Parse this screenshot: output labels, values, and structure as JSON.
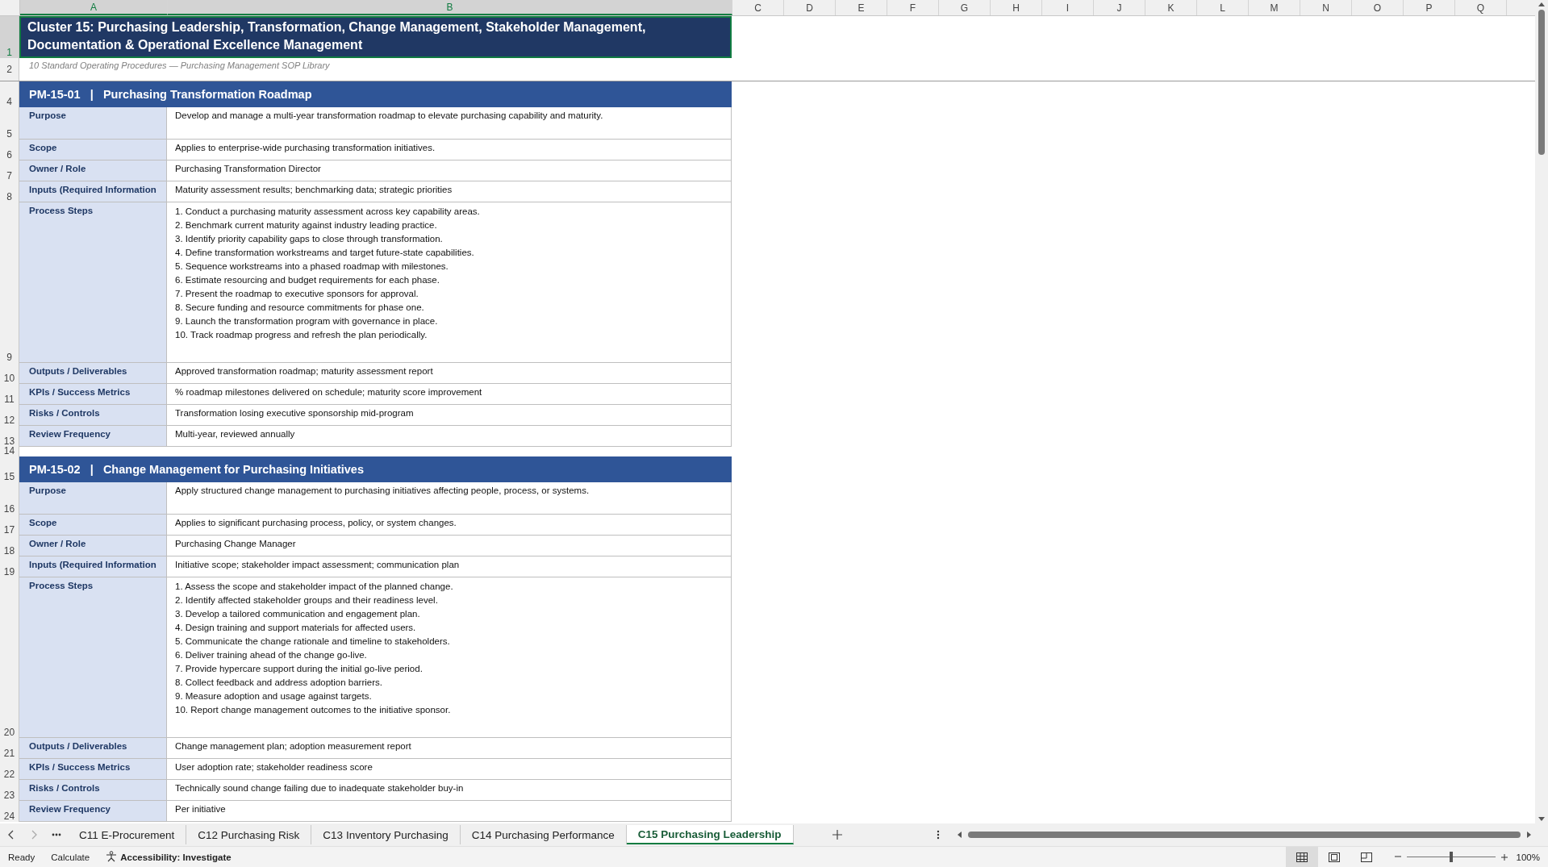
{
  "columns": [
    {
      "label": "A",
      "selected": true
    },
    {
      "label": "B",
      "selected": true
    },
    {
      "label": "C",
      "selected": false
    },
    {
      "label": "D",
      "selected": false
    },
    {
      "label": "E",
      "selected": false
    },
    {
      "label": "F",
      "selected": false
    },
    {
      "label": "G",
      "selected": false
    },
    {
      "label": "H",
      "selected": false
    },
    {
      "label": "I",
      "selected": false
    },
    {
      "label": "J",
      "selected": false
    },
    {
      "label": "K",
      "selected": false
    },
    {
      "label": "L",
      "selected": false
    },
    {
      "label": "M",
      "selected": false
    },
    {
      "label": "N",
      "selected": false
    },
    {
      "label": "O",
      "selected": false
    },
    {
      "label": "P",
      "selected": false
    },
    {
      "label": "Q",
      "selected": false
    }
  ],
  "rows": [
    {
      "kind": "title",
      "number": "1",
      "selected": true,
      "text": "Cluster 15: Purchasing Leadership, Transformation, Change Management, Stakeholder Management, Documentation & Operational Excellence Management"
    },
    {
      "kind": "subtitle",
      "number": "2",
      "selected": false,
      "text": "10 Standard Operating Procedures — Purchasing Management SOP Library"
    },
    {
      "kind": "spacer",
      "selected": false
    },
    {
      "kind": "section",
      "number": "4",
      "selected": false,
      "text": "PM-15-01   |   Purchasing Transformation Roadmap"
    },
    {
      "kind": "field_tall",
      "number": "5",
      "selected": false,
      "label": "Purpose",
      "value": "Develop and manage a multi-year transformation roadmap to elevate purchasing capability and maturity."
    },
    {
      "kind": "field",
      "number": "6",
      "selected": false,
      "label": "Scope",
      "value": "Applies to enterprise-wide purchasing transformation initiatives."
    },
    {
      "kind": "field",
      "number": "7",
      "selected": false,
      "label": "Owner / Role",
      "value": "Purchasing Transformation Director"
    },
    {
      "kind": "field",
      "number": "8",
      "selected": false,
      "label": "Inputs (Required Information",
      "value": "Maturity assessment results; benchmarking data; strategic priorities"
    },
    {
      "kind": "steps",
      "number": "9",
      "selected": false,
      "label": "Process Steps",
      "steps": [
        "1. Conduct a purchasing maturity assessment across key capability areas.",
        "2. Benchmark current maturity against industry leading practice.",
        "3. Identify priority capability gaps to close through transformation.",
        "4. Define transformation workstreams and target future-state capabilities.",
        "5. Sequence workstreams into a phased roadmap with milestones.",
        "6. Estimate resourcing and budget requirements for each phase.",
        "7. Present the roadmap to executive sponsors for approval.",
        "8. Secure funding and resource commitments for phase one.",
        "9. Launch the transformation program with governance in place.",
        "10. Track roadmap progress and refresh the plan periodically."
      ]
    },
    {
      "kind": "field",
      "number": "10",
      "selected": false,
      "label": "Outputs / Deliverables",
      "value": "Approved transformation roadmap; maturity assessment report"
    },
    {
      "kind": "field",
      "number": "11",
      "selected": false,
      "label": "KPIs / Success Metrics",
      "value": "% roadmap milestones delivered on schedule; maturity score improvement"
    },
    {
      "kind": "field",
      "number": "12",
      "selected": false,
      "label": "Risks / Controls",
      "value": "Transformation losing executive sponsorship mid-program"
    },
    {
      "kind": "field",
      "number": "13",
      "selected": false,
      "label": "Review Frequency",
      "value": "Multi-year, reviewed annually"
    },
    {
      "kind": "gap",
      "number": "14",
      "selected": false
    },
    {
      "kind": "section",
      "number": "15",
      "selected": false,
      "text": "PM-15-02   |   Change Management for Purchasing Initiatives"
    },
    {
      "kind": "field_tall",
      "number": "16",
      "selected": false,
      "label": "Purpose",
      "value": "Apply structured change management to purchasing initiatives affecting people, process, or systems."
    },
    {
      "kind": "field",
      "number": "17",
      "selected": false,
      "label": "Scope",
      "value": "Applies to significant purchasing process, policy, or system changes."
    },
    {
      "kind": "field",
      "number": "18",
      "selected": false,
      "label": "Owner / Role",
      "value": "Purchasing Change Manager"
    },
    {
      "kind": "field",
      "number": "19",
      "selected": false,
      "label": "Inputs (Required Information",
      "value": "Initiative scope; stakeholder impact assessment; communication plan"
    },
    {
      "kind": "steps",
      "number": "20",
      "selected": false,
      "label": "Process Steps",
      "steps": [
        "1. Assess the scope and stakeholder impact of the planned change.",
        "2. Identify affected stakeholder groups and their readiness level.",
        "3. Develop a tailored communication and engagement plan.",
        "4. Design training and support materials for affected users.",
        "5. Communicate the change rationale and timeline to stakeholders.",
        "6. Deliver training ahead of the change go-live.",
        "7. Provide hypercare support during the initial go-live period.",
        "8. Collect feedback and address adoption barriers.",
        "9. Measure adoption and usage against targets.",
        "10. Report change management outcomes to the initiative sponsor."
      ]
    },
    {
      "kind": "field",
      "number": "21",
      "selected": false,
      "label": "Outputs / Deliverables",
      "value": "Change management plan; adoption measurement report"
    },
    {
      "kind": "field",
      "number": "22",
      "selected": false,
      "label": "KPIs / Success Metrics",
      "value": "User adoption rate; stakeholder readiness score"
    },
    {
      "kind": "field",
      "number": "23",
      "selected": false,
      "label": "Risks / Controls",
      "value": "Technically sound change failing due to inadequate stakeholder buy-in"
    },
    {
      "kind": "field",
      "number": "24",
      "selected": false,
      "label": "Review Frequency",
      "value": "Per initiative"
    }
  ],
  "sheet_tabs": [
    {
      "label": "C11 E-Procurement",
      "selected": false
    },
    {
      "label": "C12 Purchasing Risk",
      "selected": false
    },
    {
      "label": "C13 Inventory Purchasing",
      "selected": false
    },
    {
      "label": "C14 Purchasing Performance",
      "selected": false
    },
    {
      "label": "C15 Purchasing Leadership",
      "selected": true
    }
  ],
  "status_bar": {
    "mode": "Ready",
    "calculate": "Calculate",
    "accessibility": "Accessibility: Investigate",
    "views": [
      {
        "selected": true
      },
      {
        "selected": false
      },
      {
        "selected": false
      }
    ],
    "zoom": {
      "level": 0.5,
      "reading": "100%"
    }
  }
}
